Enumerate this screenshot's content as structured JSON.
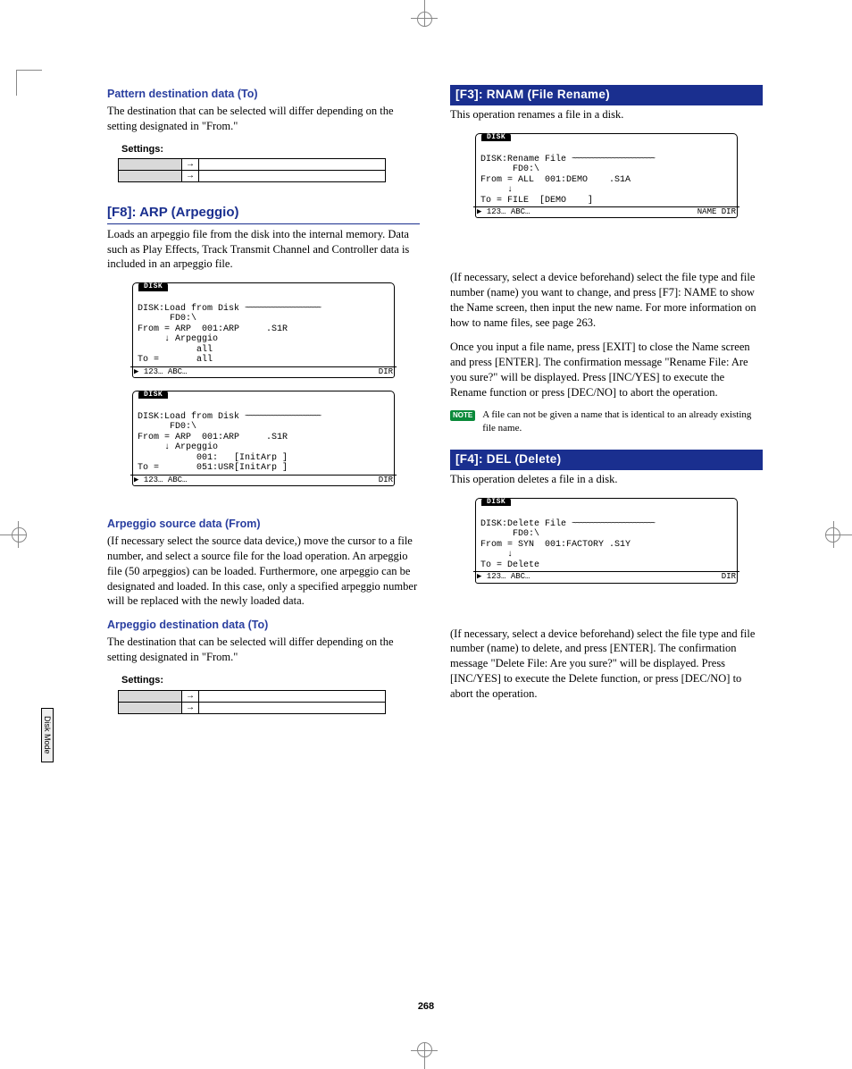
{
  "page_number": "268",
  "side_tab": "Disk Mode",
  "left": {
    "pattern_to": {
      "heading": "Pattern destination data (To)",
      "body": "The destination that can be selected will differ depending on the setting designated in \"From.\"",
      "settings_label": "Settings:"
    },
    "f8": {
      "title": "[F8]: ARP (Arpeggio)",
      "body": "Loads an arpeggio file from the disk into the internal memory. Data such as Play Effects, Track Transmit Channel and Controller data is included in an arpeggio file."
    },
    "lcd1": {
      "tab": "DISK",
      "l1": "DISK:Load from Disk",
      "l2": "      FD0:\\",
      "l3": "From = ARP  001:ARP     .S1R",
      "l4": "     ↓ Arpeggio",
      "l5": "           all",
      "l6": "To =       all",
      "foot_l": "123… ABC…",
      "foot_r": "DIR"
    },
    "lcd2": {
      "tab": "DISK",
      "l1": "DISK:Load from Disk",
      "l2": "      FD0:\\",
      "l3": "From = ARP  001:ARP     .S1R",
      "l4": "     ↓ Arpeggio",
      "l5": "           001:   [InitArp ]",
      "l6": "To =       051:USR[InitArp ]",
      "foot_l": "123… ABC…",
      "foot_r": "DIR"
    },
    "arp_from": {
      "heading": "Arpeggio source data (From)",
      "body": "(If necessary select the source data device,) move the cursor to a file number, and select a source file for the load operation. An arpeggio file (50 arpeggios) can be loaded. Furthermore, one arpeggio can be designated and loaded. In this case, only a specified arpeggio number will be replaced with the newly loaded data."
    },
    "arp_to": {
      "heading": "Arpeggio destination data (To)",
      "body": "The destination that can be selected will differ depending on the setting designated in \"From.\"",
      "settings_label": "Settings:"
    }
  },
  "right": {
    "f3": {
      "bar": "[F3]: RNAM (File Rename)",
      "intro": "This operation renames a file in a disk."
    },
    "lcd3": {
      "tab": "DISK",
      "l1": "DISK:Rename File",
      "l2": "      FD0:\\",
      "l3": "From = ALL  001:DEMO    .S1A",
      "l4": "     ↓",
      "l5": "To = FILE  [DEMO    ]",
      "foot_l": "123… ABC…",
      "foot_r": "NAME DIR"
    },
    "f3_body1": "(If necessary, select a device beforehand) select the file type and file number (name) you want to change, and press [F7]: NAME to show the Name screen, then input the new name. For more information on how to name files, see page 263.",
    "f3_body2": "Once you input a file name, press [EXIT] to close the Name screen and press [ENTER]. The confirmation message \"Rename File: Are you sure?\" will be displayed. Press [INC/YES] to execute the Rename function or press [DEC/NO] to abort the operation.",
    "note_label": "NOTE",
    "note_text": "A file can not be given a name that is identical to an already existing file name.",
    "f4": {
      "bar": "[F4]: DEL (Delete)",
      "intro": "This operation deletes a file in a disk."
    },
    "lcd4": {
      "tab": "DISK",
      "l1": "DISK:Delete File",
      "l2": "      FD0:\\",
      "l3": "From = SYN  001:FACTORY .S1Y",
      "l4": "     ↓",
      "l5": "To = Delete",
      "foot_l": "123… ABC…",
      "foot_r": "DIR"
    },
    "f4_body": "(If necessary, select a device beforehand) select the file type and file number (name) to delete, and press [ENTER]. The confirmation message \"Delete File: Are you sure?\" will be displayed. Press [INC/YES] to execute the Delete function, or press [DEC/NO] to abort the operation."
  }
}
